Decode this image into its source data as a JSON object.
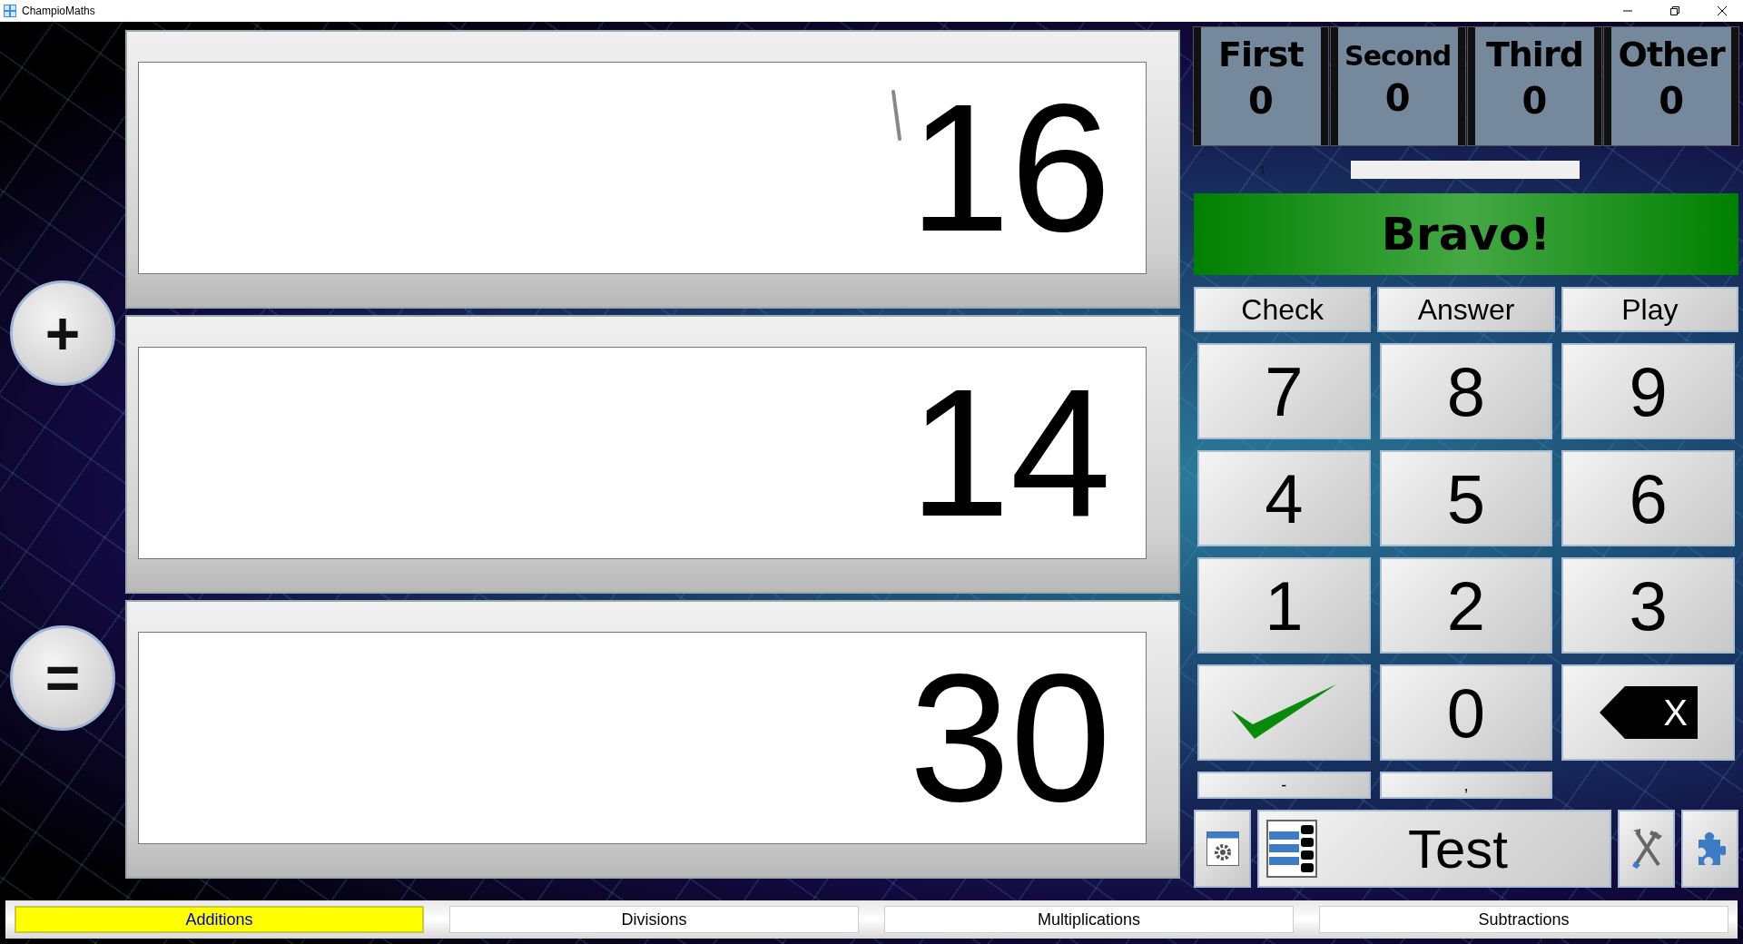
{
  "window": {
    "title": "ChampioMaths"
  },
  "operators": [
    {
      "symbol": "+"
    },
    {
      "symbol": "="
    }
  ],
  "fields": [
    {
      "value": "16"
    },
    {
      "value": "14"
    },
    {
      "value": "30"
    }
  ],
  "scores": [
    {
      "label": "First",
      "value": "0"
    },
    {
      "label": "Second",
      "value": "0"
    },
    {
      "label": "Third",
      "value": "0"
    },
    {
      "label": "Other",
      "value": "0"
    }
  ],
  "progress": {
    "label": "1"
  },
  "message": "Bravo!",
  "actions": [
    "Check",
    "Answer",
    "Play"
  ],
  "keypad": [
    {
      "kind": "digit",
      "label": "7"
    },
    {
      "kind": "digit",
      "label": "8"
    },
    {
      "kind": "digit",
      "label": "9"
    },
    {
      "kind": "digit",
      "label": "4"
    },
    {
      "kind": "digit",
      "label": "5"
    },
    {
      "kind": "digit",
      "label": "6"
    },
    {
      "kind": "digit",
      "label": "1"
    },
    {
      "kind": "digit",
      "label": "2"
    },
    {
      "kind": "digit",
      "label": "3"
    },
    {
      "kind": "confirm"
    },
    {
      "kind": "digit",
      "label": "0"
    },
    {
      "kind": "delete",
      "label": "X"
    },
    {
      "kind": "small",
      "label": "-"
    },
    {
      "kind": "small",
      "label": ","
    }
  ],
  "test_button": {
    "label": "Test"
  },
  "tabs": [
    {
      "label": "Additions",
      "selected": true
    },
    {
      "label": "Divisions",
      "selected": false
    },
    {
      "label": "Multiplications",
      "selected": false
    },
    {
      "label": "Subtractions",
      "selected": false
    }
  ]
}
